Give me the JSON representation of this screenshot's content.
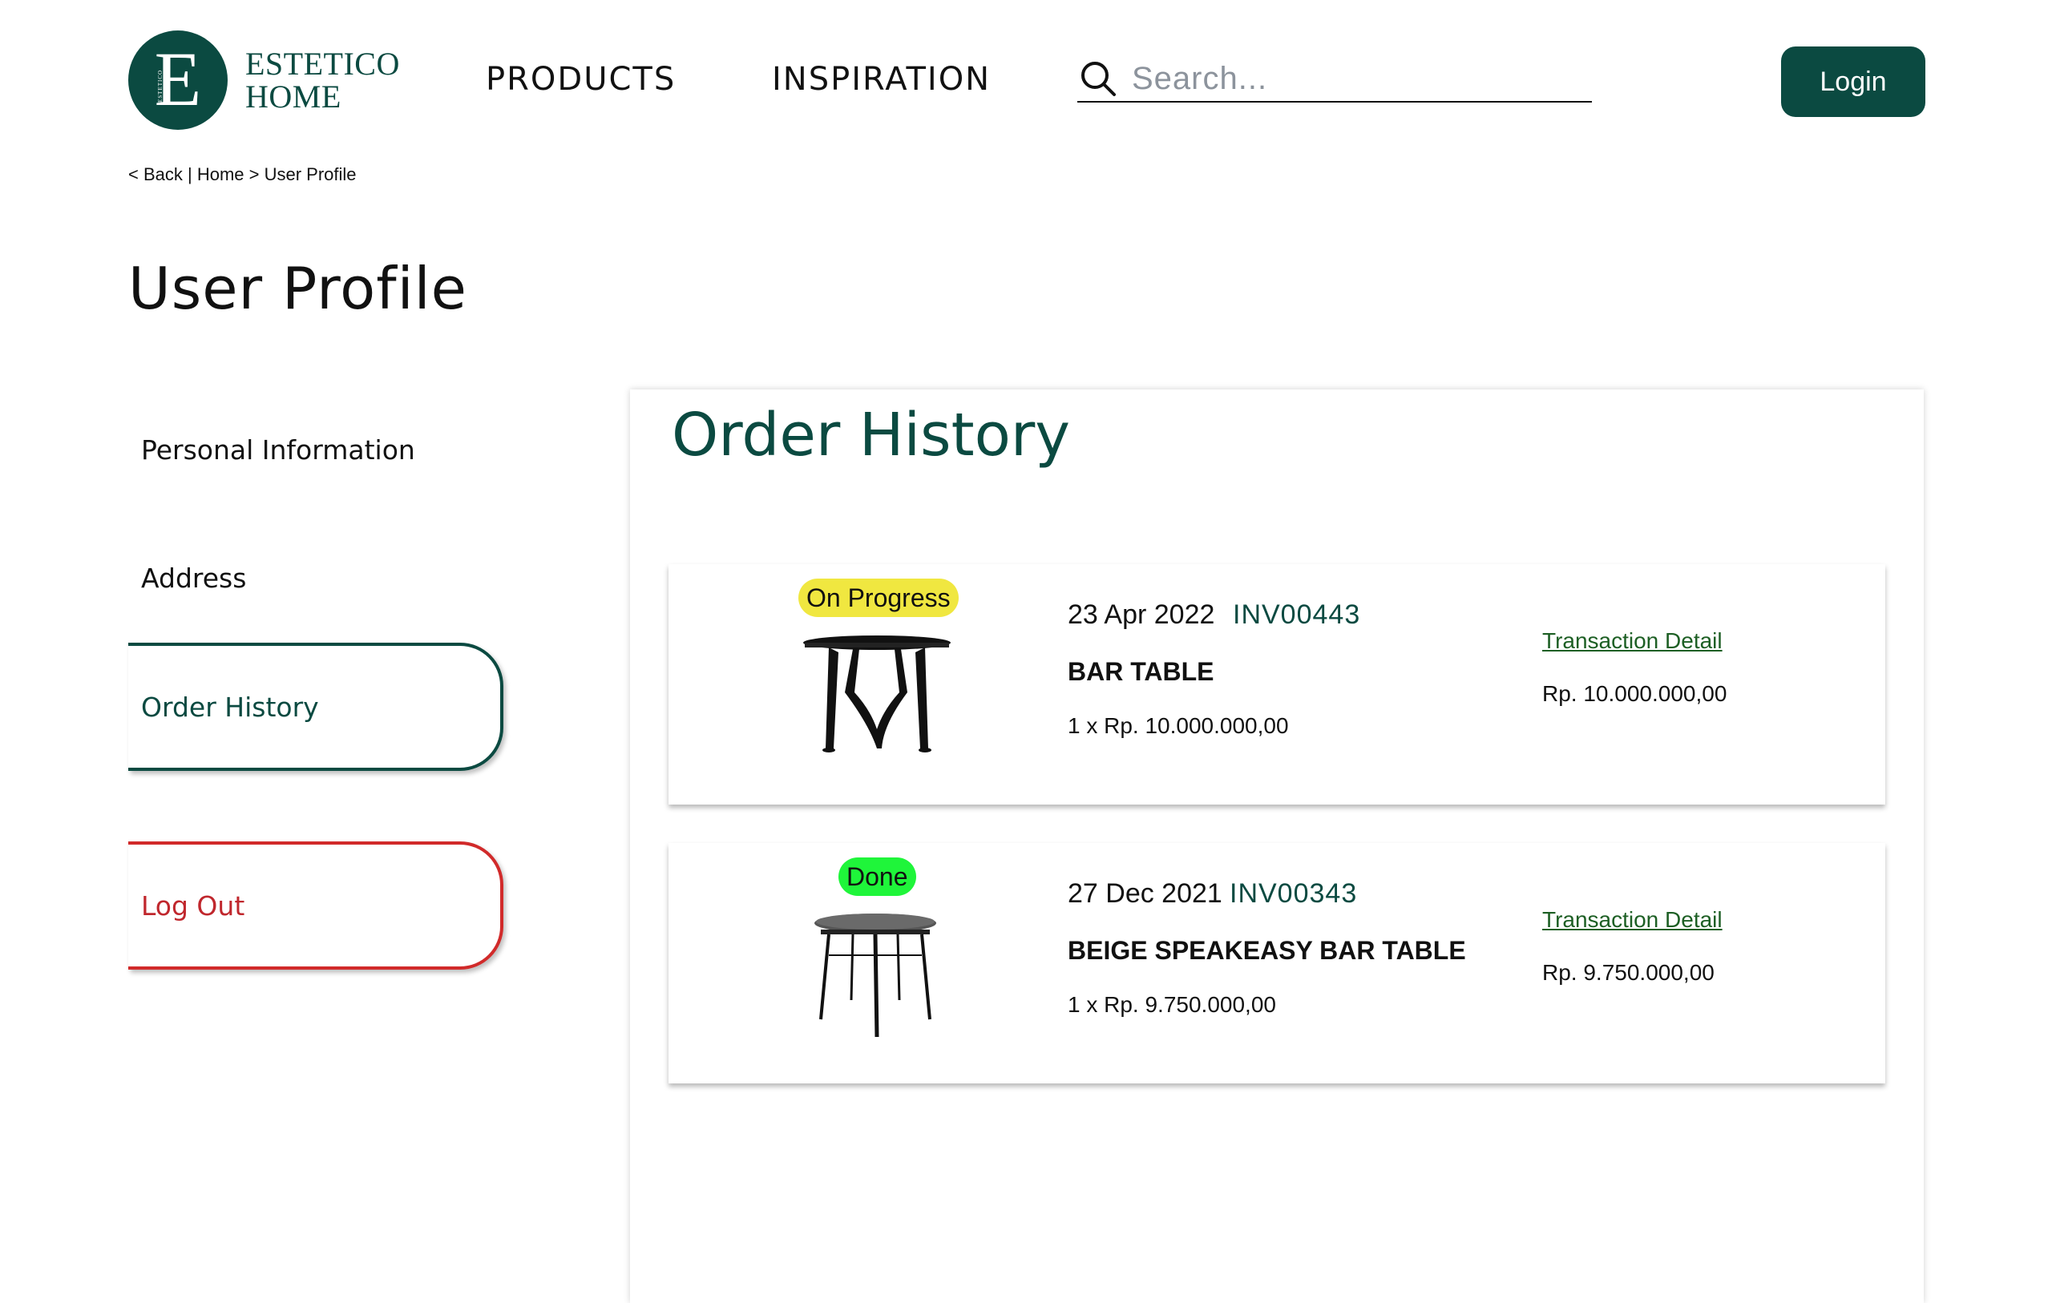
{
  "brand": {
    "line1": "ESTETICO",
    "line2": "HOME",
    "logo_letter": "E",
    "logo_small": "ESTETICO"
  },
  "nav": {
    "products": "PRODUCTS",
    "inspiration": "INSPIRATION"
  },
  "search": {
    "placeholder": "Search..."
  },
  "header": {
    "login_label": "Login"
  },
  "breadcrumb": {
    "back": "< Back",
    "sep": " | ",
    "home": "Home",
    "arrow": " > ",
    "current": "User Profile"
  },
  "page": {
    "title": "User Profile"
  },
  "sidebar": {
    "items": [
      {
        "label": "Personal Information"
      },
      {
        "label": "Address"
      },
      {
        "label": "Order History"
      },
      {
        "label": "Log Out"
      }
    ]
  },
  "order_history": {
    "title": "Order History",
    "orders": [
      {
        "status": "On Progress",
        "date": "23 Apr 2022",
        "invoice": "INV00443",
        "product": "BAR TABLE",
        "quantity_line": "1 x Rp. 10.000.000,00",
        "detail_link": "Transaction Detail",
        "total": "Rp. 10.000.000,00"
      },
      {
        "status": "Done",
        "date": "27 Dec 2021",
        "invoice": "INV00343",
        "product": "BEIGE SPEAKEASY BAR TABLE",
        "quantity_line": "1 x Rp. 9.750.000,00",
        "detail_link": "Transaction Detail",
        "total": "Rp. 9.750.000,00"
      }
    ]
  },
  "colors": {
    "brand": "#0b4a41",
    "logout": "#c0272d",
    "status_progress": "#f0e740",
    "status_done": "#1ff53a",
    "link": "#1d5f24"
  }
}
